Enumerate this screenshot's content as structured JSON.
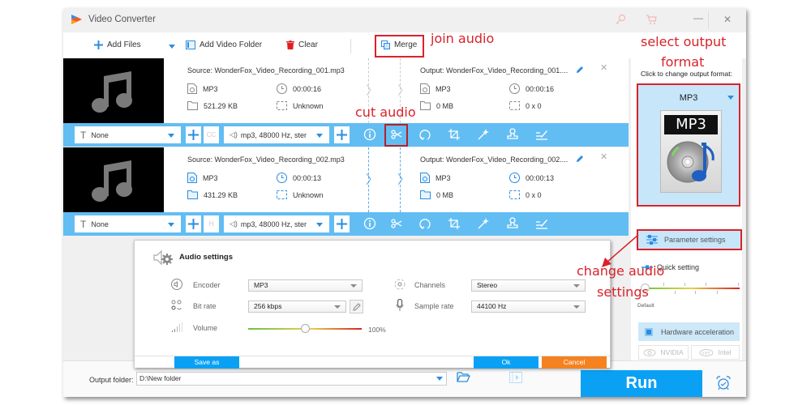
{
  "window": {
    "title": "Video Converter",
    "controls": {
      "minimize": "—",
      "close": "✕"
    }
  },
  "toolbar": {
    "add_files": "Add Files",
    "add_video_folder": "Add Video Folder",
    "clear": "Clear",
    "merge": "Merge"
  },
  "files": [
    {
      "source": "Source: WonderFox_Video_Recording_001.mp3",
      "output": "Output: WonderFox_Video_Recording_001....",
      "src_format": "MP3",
      "src_duration": "00:00:16",
      "src_size": "521.29 KB",
      "src_resolution": "Unknown",
      "out_format": "MP3",
      "out_duration": "00:00:16",
      "out_size": "0 MB",
      "out_resolution": "0 x 0",
      "subtitle": "None",
      "audio_track": "mp3, 48000 Hz, ster"
    },
    {
      "source": "Source: WonderFox_Video_Recording_002.mp3",
      "output": "Output: WonderFox_Video_Recording_002....",
      "src_format": "MP3",
      "src_duration": "00:00:13",
      "src_size": "431.29 KB",
      "src_resolution": "Unknown",
      "out_format": "MP3",
      "out_duration": "00:00:13",
      "out_size": "0 MB",
      "out_resolution": "0 x 0",
      "subtitle": "None",
      "audio_track": "mp3, 48000 Hz, ster"
    }
  ],
  "right_panel": {
    "caption": "Click to change output format:",
    "format": "MP3",
    "format_icon_text": "MP3",
    "parameter_settings": "Parameter settings",
    "quick_setting": "Quick setting",
    "quick_default": "Default",
    "hardware_acceleration": "Hardware acceleration",
    "nvidia": "NVIDIA",
    "intel": "Intel"
  },
  "bottom": {
    "output_folder_label": "Output folder:",
    "output_folder_value": "D:\\New folder",
    "run": "Run"
  },
  "dialog": {
    "title": "Audio settings",
    "encoder_label": "Encoder",
    "encoder_value": "MP3",
    "bitrate_label": "Bit rate",
    "bitrate_value": "256 kbps",
    "volume_label": "Volume",
    "volume_value": "100%",
    "volume_fraction": 0.5,
    "channels_label": "Channels",
    "channels_value": "Stereo",
    "samplerate_label": "Sample rate",
    "samplerate_value": "44100 Hz",
    "save_as": "Save as",
    "ok": "Ok",
    "cancel": "Cancel"
  },
  "annotations": {
    "join_audio": "join audio",
    "select_output_format_1": "select output",
    "select_output_format_2": "format",
    "cut_audio": "cut audio",
    "change_audio_settings_1": "change audio",
    "change_audio_settings_2": "settings"
  },
  "colors": {
    "accent": "#0aa1f5",
    "bar_blue": "#62bdf3",
    "annotation_red": "#d9222a",
    "cancel_orange": "#f58220"
  }
}
